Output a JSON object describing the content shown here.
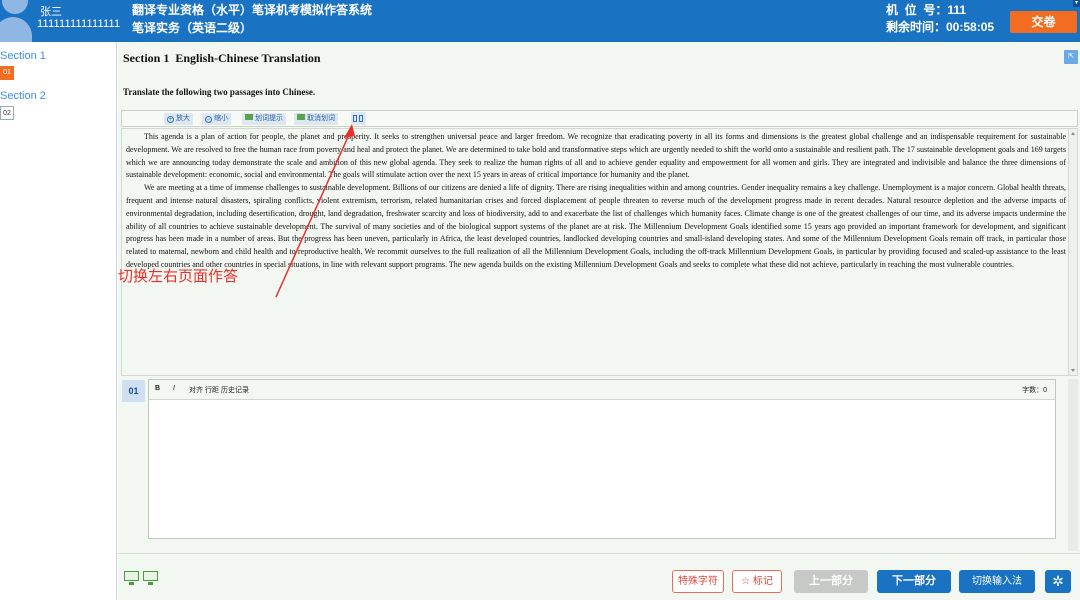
{
  "header": {
    "user_name": "张三",
    "user_id": "111111111111111",
    "system_title": "翻译专业资格（水平）笔译机考模拟作答系统",
    "subtitle": "笔译实务（英语二级）",
    "seat_label": "机  位  号：111",
    "time_label": "剩余时间：00:58:05",
    "submit_label": "交卷",
    "accent_color": "#1a72c2",
    "submit_color": "#f26c22"
  },
  "sidebar": {
    "sections": [
      {
        "label": "Section 1",
        "questions": [
          "01"
        ],
        "active": "01"
      },
      {
        "label": "Section 2",
        "questions": [
          "02"
        ],
        "active": ""
      }
    ]
  },
  "main": {
    "section_title": "Section 1  English-Chinese Translation",
    "collapse_icon": "collapse-icon",
    "instruction": "Translate the following two passages into Chinese.",
    "passage_toolbar": {
      "zoom_in": "放大",
      "zoom_out": "缩小",
      "highlight": "划词提示",
      "cancel_highlight": "取消划词",
      "switch_layout_icon": "split-view-icon"
    },
    "passage": {
      "paragraphs": [
        "This agenda is a plan of action for people, the planet and prosperity. It seeks to strengthen universal peace and larger freedom. We recognize that eradicating poverty in all its forms and dimensions is the greatest global challenge and an indispensable requirement for sustainable development. We are resolved to free the human race from poverty and heal and protect the planet. We are determined to take bold and transformative steps which are urgently needed to shift the world onto a sustainable and resilient path. The 17 sustainable development goals and 169 targets which we are announcing today demonstrate the scale and ambition of this new global agenda. They seek to realize the human rights of all and to achieve gender equality and empowerment for all women and girls. They are integrated and indivisible and balance the three dimensions of sustainable development: economic, social and environmental. The goals will stimulate action over the next 15 years in areas of critical importance for humanity and the planet.",
        "We are meeting at a time of immense challenges to sustainable development. Billions of our citizens are denied a life of dignity. There are rising inequalities within and among countries. Gender inequality remains a key challenge. Unemployment is a major concern. Global health threats, frequent and intense natural disasters, spiraling conflicts, violent extremism, terrorism, related humanitarian crises and forced displacement of people threaten to reverse much of the development progress made in recent decades. Natural resource depletion and the adverse impacts of environmental degradation, including desertification, drought, land degradation, freshwater scarcity and loss of biodiversity, add to and exacerbate the list of challenges which humanity faces. Climate change is one of the greatest challenges of our time, and its adverse impacts undermine the ability of all countries to achieve sustainable development. The survival of many societies and of the biological support systems of the planet are at risk. The Millennium Development Goals identified some 15 years ago provided an important framework for development, and significant progress has been made in a number of areas. But the progress has been uneven, particularly in Africa, the least developed countries, landlocked developing countries and small-island developing states. And some of the Millennium Development Goals remain off track, in particular those related to maternal, newborn and child health and to reproductive health. We recommit ourselves to the full realization of all the Millennium Development Goals, including the off-track Millennium Development Goals, in particular by providing focused and scaled-up assistance to the least developed countries and other countries in special situations, in line with relevant support programs. The new agenda builds on the existing Millennium Development Goals and seeks to complete what these did not achieve, particularly in reaching the most vulnerable countries."
      ]
    },
    "annotation": "切换左右页面作答",
    "annotation_color": "#e8302a",
    "answer": {
      "question_number": "01",
      "toolbar": {
        "bold": "B",
        "italic": "I",
        "align": "对齐",
        "line_height": "行距",
        "history": "历史记录",
        "word_count": "字数：0"
      }
    }
  },
  "footer": {
    "special_chars": "特殊字符",
    "mark": "标记",
    "prev": "上一部分",
    "next": "下一部分",
    "switch_input": "切换输入法",
    "settings_icon": "gear-icon",
    "layout_icons": [
      "monitor-icon",
      "monitor-icon"
    ]
  }
}
